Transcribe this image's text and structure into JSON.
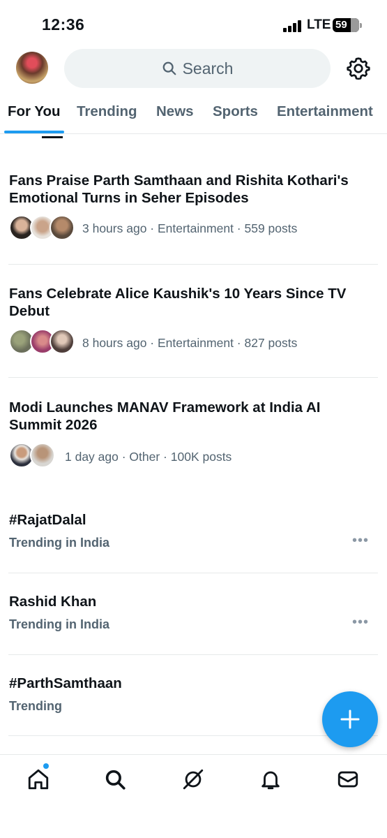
{
  "status_bar": {
    "time": "12:36",
    "network": "LTE",
    "battery": "59"
  },
  "header": {
    "search_placeholder": "Search"
  },
  "tabs": [
    {
      "label": "For You",
      "active": true
    },
    {
      "label": "Trending",
      "active": false
    },
    {
      "label": "News",
      "active": false
    },
    {
      "label": "Sports",
      "active": false
    },
    {
      "label": "Entertainment",
      "active": false
    }
  ],
  "news": [
    {
      "title": "Fans Praise Parth Samthaan and Rishita Kothari's Emotional Turns in Seher Episodes",
      "meta": "3 hours ago · Entertainment · 559 posts"
    },
    {
      "title": "Fans Celebrate Alice Kaushik's 10 Years Since TV Debut",
      "meta": "8 hours ago · Entertainment · 827 posts"
    },
    {
      "title": "Modi Launches MANAV Framework at India AI Summit 2026",
      "meta": "1 day ago · Other · 100K posts"
    }
  ],
  "trends": [
    {
      "name": "#RajatDalal",
      "context": "Trending in India"
    },
    {
      "name": "Rashid Khan",
      "context": "Trending in India"
    },
    {
      "name": "#ParthSamthaan",
      "context": "Trending"
    }
  ],
  "colors": {
    "accent": "#1d9bf0",
    "text": "#0f1419",
    "secondary": "#536471"
  },
  "nav": [
    "home-icon",
    "search-icon",
    "grok-icon",
    "notifications-icon",
    "messages-icon"
  ]
}
